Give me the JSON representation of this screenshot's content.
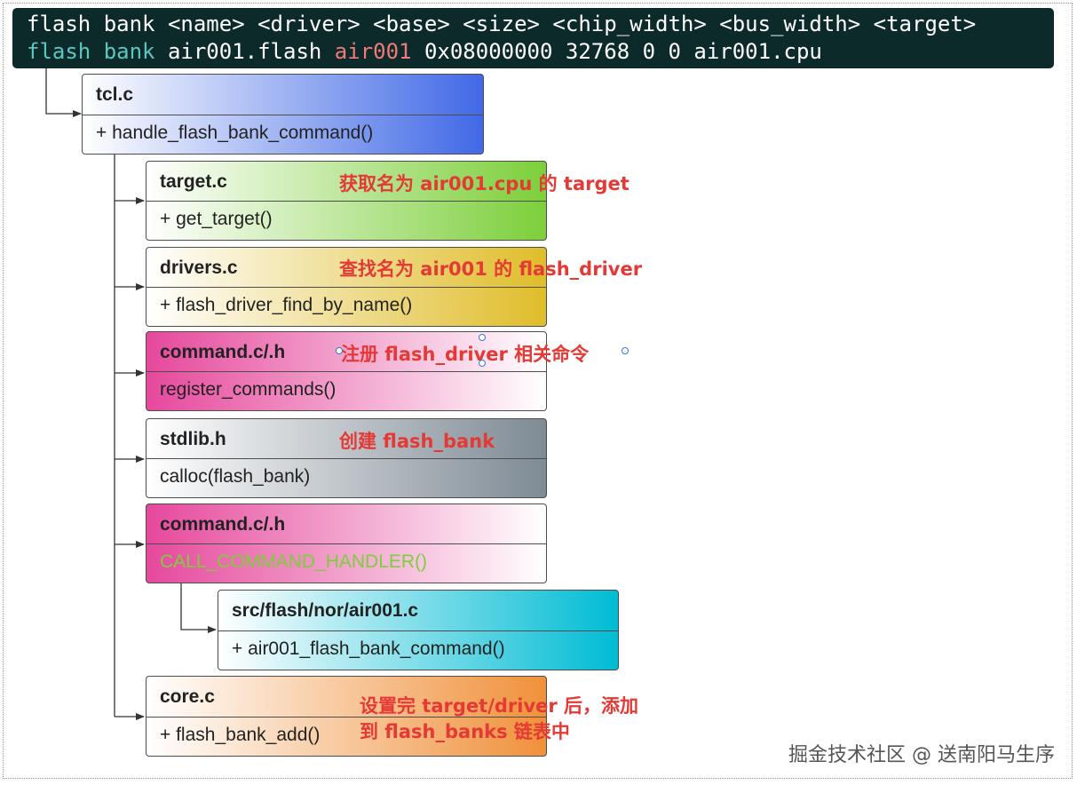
{
  "command": {
    "line1": "flash bank <name> <driver> <base> <size> <chip_width> <bus_width> <target>",
    "line2_prefix": "flash bank",
    "line2_name": " air001.flash ",
    "line2_driver": "air001",
    "line2_rest": " 0x08000000 32768 0 0 air001.cpu"
  },
  "nodes": [
    {
      "id": "tcl",
      "title": "tcl.c",
      "member": "+ handle_flash_bank_command()",
      "gradient": [
        "#ffffff",
        "#4169e6"
      ]
    },
    {
      "id": "target",
      "title": "target.c",
      "member": "+ get_target()",
      "gradient": [
        "#ffffff",
        "#7ccf3a"
      ]
    },
    {
      "id": "drivers",
      "title": "drivers.c",
      "member": "+ flash_driver_find_by_name()",
      "gradient": [
        "#ffffff",
        "#e0bd2a"
      ]
    },
    {
      "id": "command1",
      "title": "command.c/.h",
      "member": "register_commands()",
      "gradient": [
        "#e6489c",
        "#ffffff"
      ]
    },
    {
      "id": "stdlib",
      "title": "stdlib.h",
      "member": "calloc(flash_bank)",
      "gradient": [
        "#ffffff",
        "#7e8a94"
      ]
    },
    {
      "id": "command2",
      "title": "command.c/.h",
      "member": "CALL_COMMAND_HANDLER()",
      "gradient": [
        "#e6489c",
        "#ffffff"
      ],
      "member_color": "#7ccf3a"
    },
    {
      "id": "air001",
      "title": "src/flash/nor/air001.c",
      "member": "+ air001_flash_bank_command()",
      "gradient": [
        "#ffffff",
        "#00bcd4"
      ]
    },
    {
      "id": "core",
      "title": "core.c",
      "member": "+ flash_bank_add()",
      "gradient": [
        "#ffffff",
        "#f0913a"
      ]
    }
  ],
  "annotations": {
    "target": "获取名为 air001.cpu 的 target",
    "drivers": "查找名为 air001 的 flash_driver",
    "command1": "注册 flash_driver 相关命令",
    "stdlib": "创建 flash_bank",
    "core_line1": "设置完 target/driver 后，添加",
    "core_line2": "到 flash_banks 链表中"
  },
  "colors": {
    "annotation": "#e53935",
    "command_bg": "#0d2a2a",
    "command_teal": "#5cc6c0",
    "command_red": "#f07a7a"
  },
  "watermark": "掘金技术社区 @ 送南阳马生序"
}
